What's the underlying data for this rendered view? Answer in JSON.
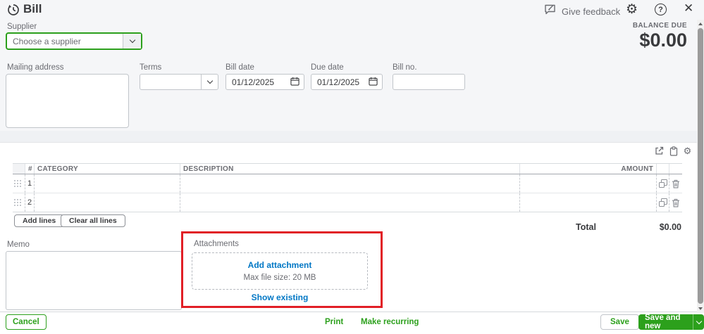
{
  "header": {
    "title": "Bill",
    "give_feedback_label": "Give feedback",
    "balance_due_label": "BALANCE DUE",
    "balance_due_amount": "$0.00"
  },
  "form": {
    "supplier_label": "Supplier",
    "supplier_placeholder": "Choose a supplier",
    "mailing_address_label": "Mailing address",
    "terms_label": "Terms",
    "bill_date_label": "Bill date",
    "bill_date_value": "01/12/2025",
    "due_date_label": "Due date",
    "due_date_value": "01/12/2025",
    "bill_no_label": "Bill no."
  },
  "table": {
    "headers": {
      "num": "#",
      "category": "CATEGORY",
      "description": "DESCRIPTION",
      "amount": "AMOUNT"
    },
    "rows": [
      {
        "num": "1"
      },
      {
        "num": "2"
      }
    ],
    "add_lines_label": "Add lines",
    "clear_all_lines_label": "Clear all lines",
    "total_label": "Total",
    "total_value": "$0.00"
  },
  "memo": {
    "label": "Memo"
  },
  "attachments": {
    "label": "Attachments",
    "add_attachment_label": "Add attachment",
    "max_file_size_text": "Max file size: 20 MB",
    "show_existing_label": "Show existing"
  },
  "footer": {
    "cancel_label": "Cancel",
    "print_label": "Print",
    "make_recurring_label": "Make recurring",
    "save_label": "Save",
    "save_and_new_label": "Save and new"
  },
  "colors": {
    "brand_green": "#2ca01c",
    "link_blue": "#0077c5",
    "annotation_red": "#e11f26",
    "text_dark": "#393a3d",
    "text_gray": "#6b6c72",
    "header_bg": "#f5f6f8"
  }
}
